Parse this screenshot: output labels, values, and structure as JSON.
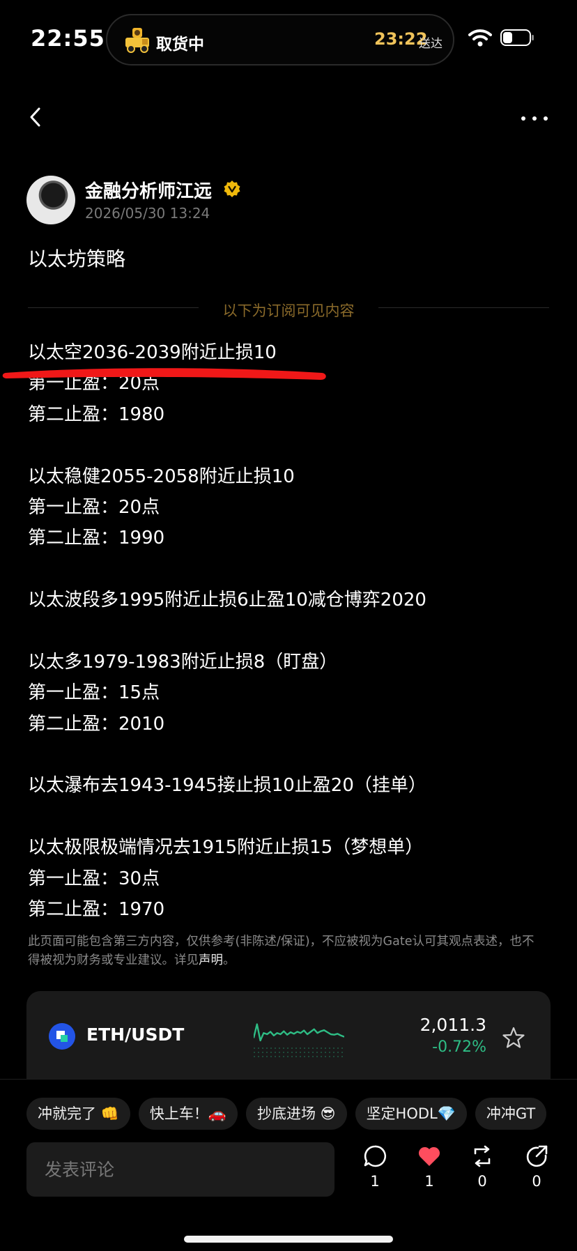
{
  "status_bar": {
    "time": "22:55",
    "activity_label": "取货中",
    "activity_time": "23:22",
    "activity_suffix": "送达"
  },
  "author": {
    "name": "金融分析师江远",
    "timestamp": "2026/05/30 13:24"
  },
  "post": {
    "title": "以太坊策略",
    "divider_label": "以下为订阅可见内容",
    "lines": [
      "以太空2036-2039附近止损10",
      "第一止盈：20点",
      "第二止盈：1980",
      "",
      "以太稳健2055-2058附近止损10",
      "第一止盈：20点",
      "第二止盈：1990",
      "",
      "以太波段多1995附近止损6止盈10减仓博弈2020",
      "",
      "以太多1979-1983附近止损8（盯盘）",
      "第一止盈：15点",
      "第二止盈：2010",
      "",
      "以太瀑布去1943-1945接止损10止盈20（挂单）",
      "",
      "以太极限极端情况去1915附近止损15（梦想单）",
      "第一止盈：30点",
      "第二止盈：1970"
    ],
    "disclaimer": "此页面可能包含第三方内容，仅供参考(非陈述/保证)，不应被视为Gate认可其观点表述，也不得被视为财务或专业建议。详见",
    "disclaimer_link": "声明",
    "disclaimer_end": "。"
  },
  "ticker": {
    "pair": "ETH/USDT",
    "price": "2,011.3",
    "change": "-0.72%",
    "change_color": "#2ebd85",
    "sparkline": [
      0.35,
      0.9,
      0.25,
      0.55,
      0.5,
      0.6,
      0.45,
      0.55,
      0.5,
      0.62,
      0.48,
      0.58,
      0.52,
      0.6,
      0.55,
      0.65,
      0.5,
      0.6,
      0.7,
      0.55,
      0.62,
      0.66,
      0.58,
      0.5,
      0.48,
      0.52,
      0.45,
      0.4
    ]
  },
  "quick_replies": [
    "冲就完了 👊",
    "快上车！🚗",
    "抄底进场 😎",
    "坚定HODL💎",
    "冲冲GT"
  ],
  "comment": {
    "placeholder": "发表评论"
  },
  "actions": {
    "comments": "1",
    "likes": "1",
    "reposts": "0",
    "shares": "0",
    "like_color": "#ff4d5e"
  }
}
